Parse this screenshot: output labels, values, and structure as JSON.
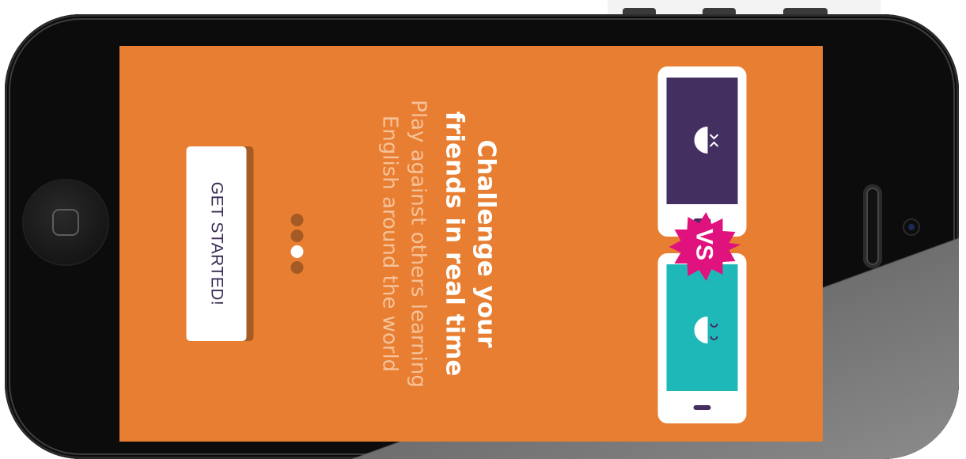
{
  "onboarding": {
    "title_line1": "Challenge your",
    "title_line2": "friends in real time",
    "subtitle_line1": "Play against others learning",
    "subtitle_line2": "English around the world",
    "vs_label": "VS",
    "cta_label": "GET STARTED!",
    "page_indicator": {
      "total": 4,
      "active_index": 2
    }
  },
  "colors": {
    "screen_background": "#e87e31",
    "teal_phone": "#1fb8b8",
    "purple_phone": "#433060",
    "vs_badge": "#e0127e",
    "button_text": "#3a2a53"
  }
}
